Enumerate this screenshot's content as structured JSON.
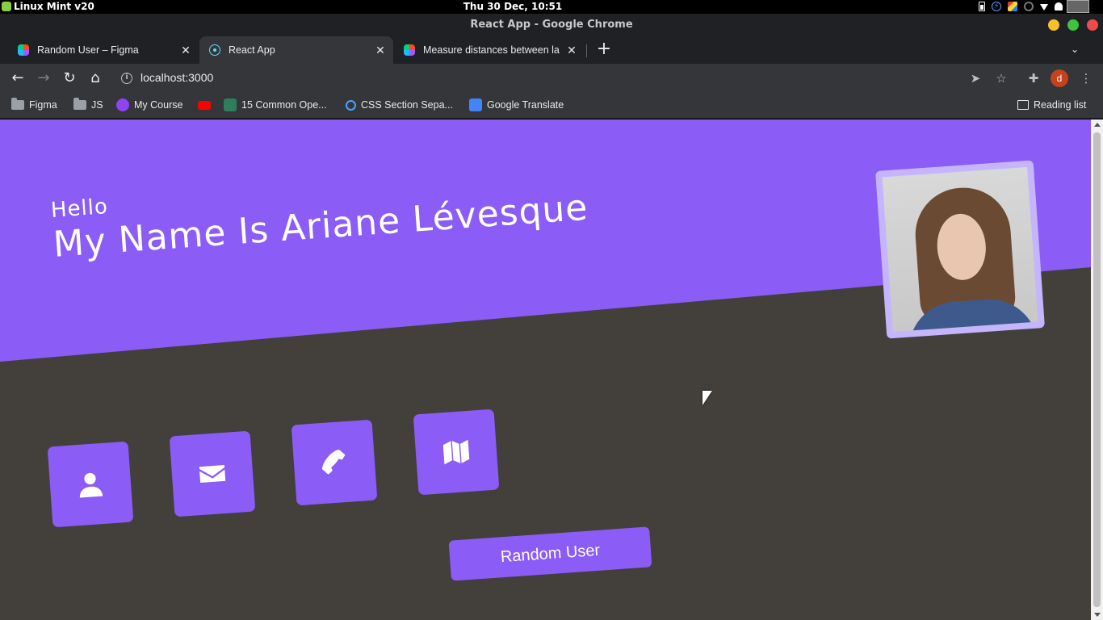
{
  "os": {
    "menu_label": "Linux Mint v20",
    "clock": "Thu 30 Dec, 10:51"
  },
  "window": {
    "title": "React App - Google Chrome"
  },
  "tabs": [
    {
      "title": "Random User – Figma",
      "favicon": "figma-icon",
      "active": false
    },
    {
      "title": "React App",
      "favicon": "react-icon",
      "active": true
    },
    {
      "title": "Measure distances between la",
      "favicon": "figma-icon",
      "active": false
    }
  ],
  "toolbar": {
    "url": "localhost:3000",
    "profile_initial": "d"
  },
  "bookmarks": [
    {
      "label": "Figma",
      "icon": "folder-icon"
    },
    {
      "label": "JS",
      "icon": "folder-icon"
    },
    {
      "label": "My Course",
      "icon": "course-icon"
    },
    {
      "label": "",
      "icon": "youtube-icon"
    },
    {
      "label": "15 Common Ope...",
      "icon": "dp-icon"
    },
    {
      "label": "CSS Section Sepa...",
      "icon": "codepen-icon"
    },
    {
      "label": "Google Translate",
      "icon": "translate-icon"
    }
  ],
  "reading_list": "Reading list",
  "page": {
    "hello": "Hello",
    "name_line": "My Name Is Ariane Lévesque",
    "button_label": "Random User",
    "info_icons": [
      "user-icon",
      "envelope-icon",
      "phone-icon",
      "map-icon"
    ]
  },
  "colors": {
    "accent": "#8b5cf6",
    "frame": "#c4b5fd",
    "page_bg": "#433f3b"
  }
}
